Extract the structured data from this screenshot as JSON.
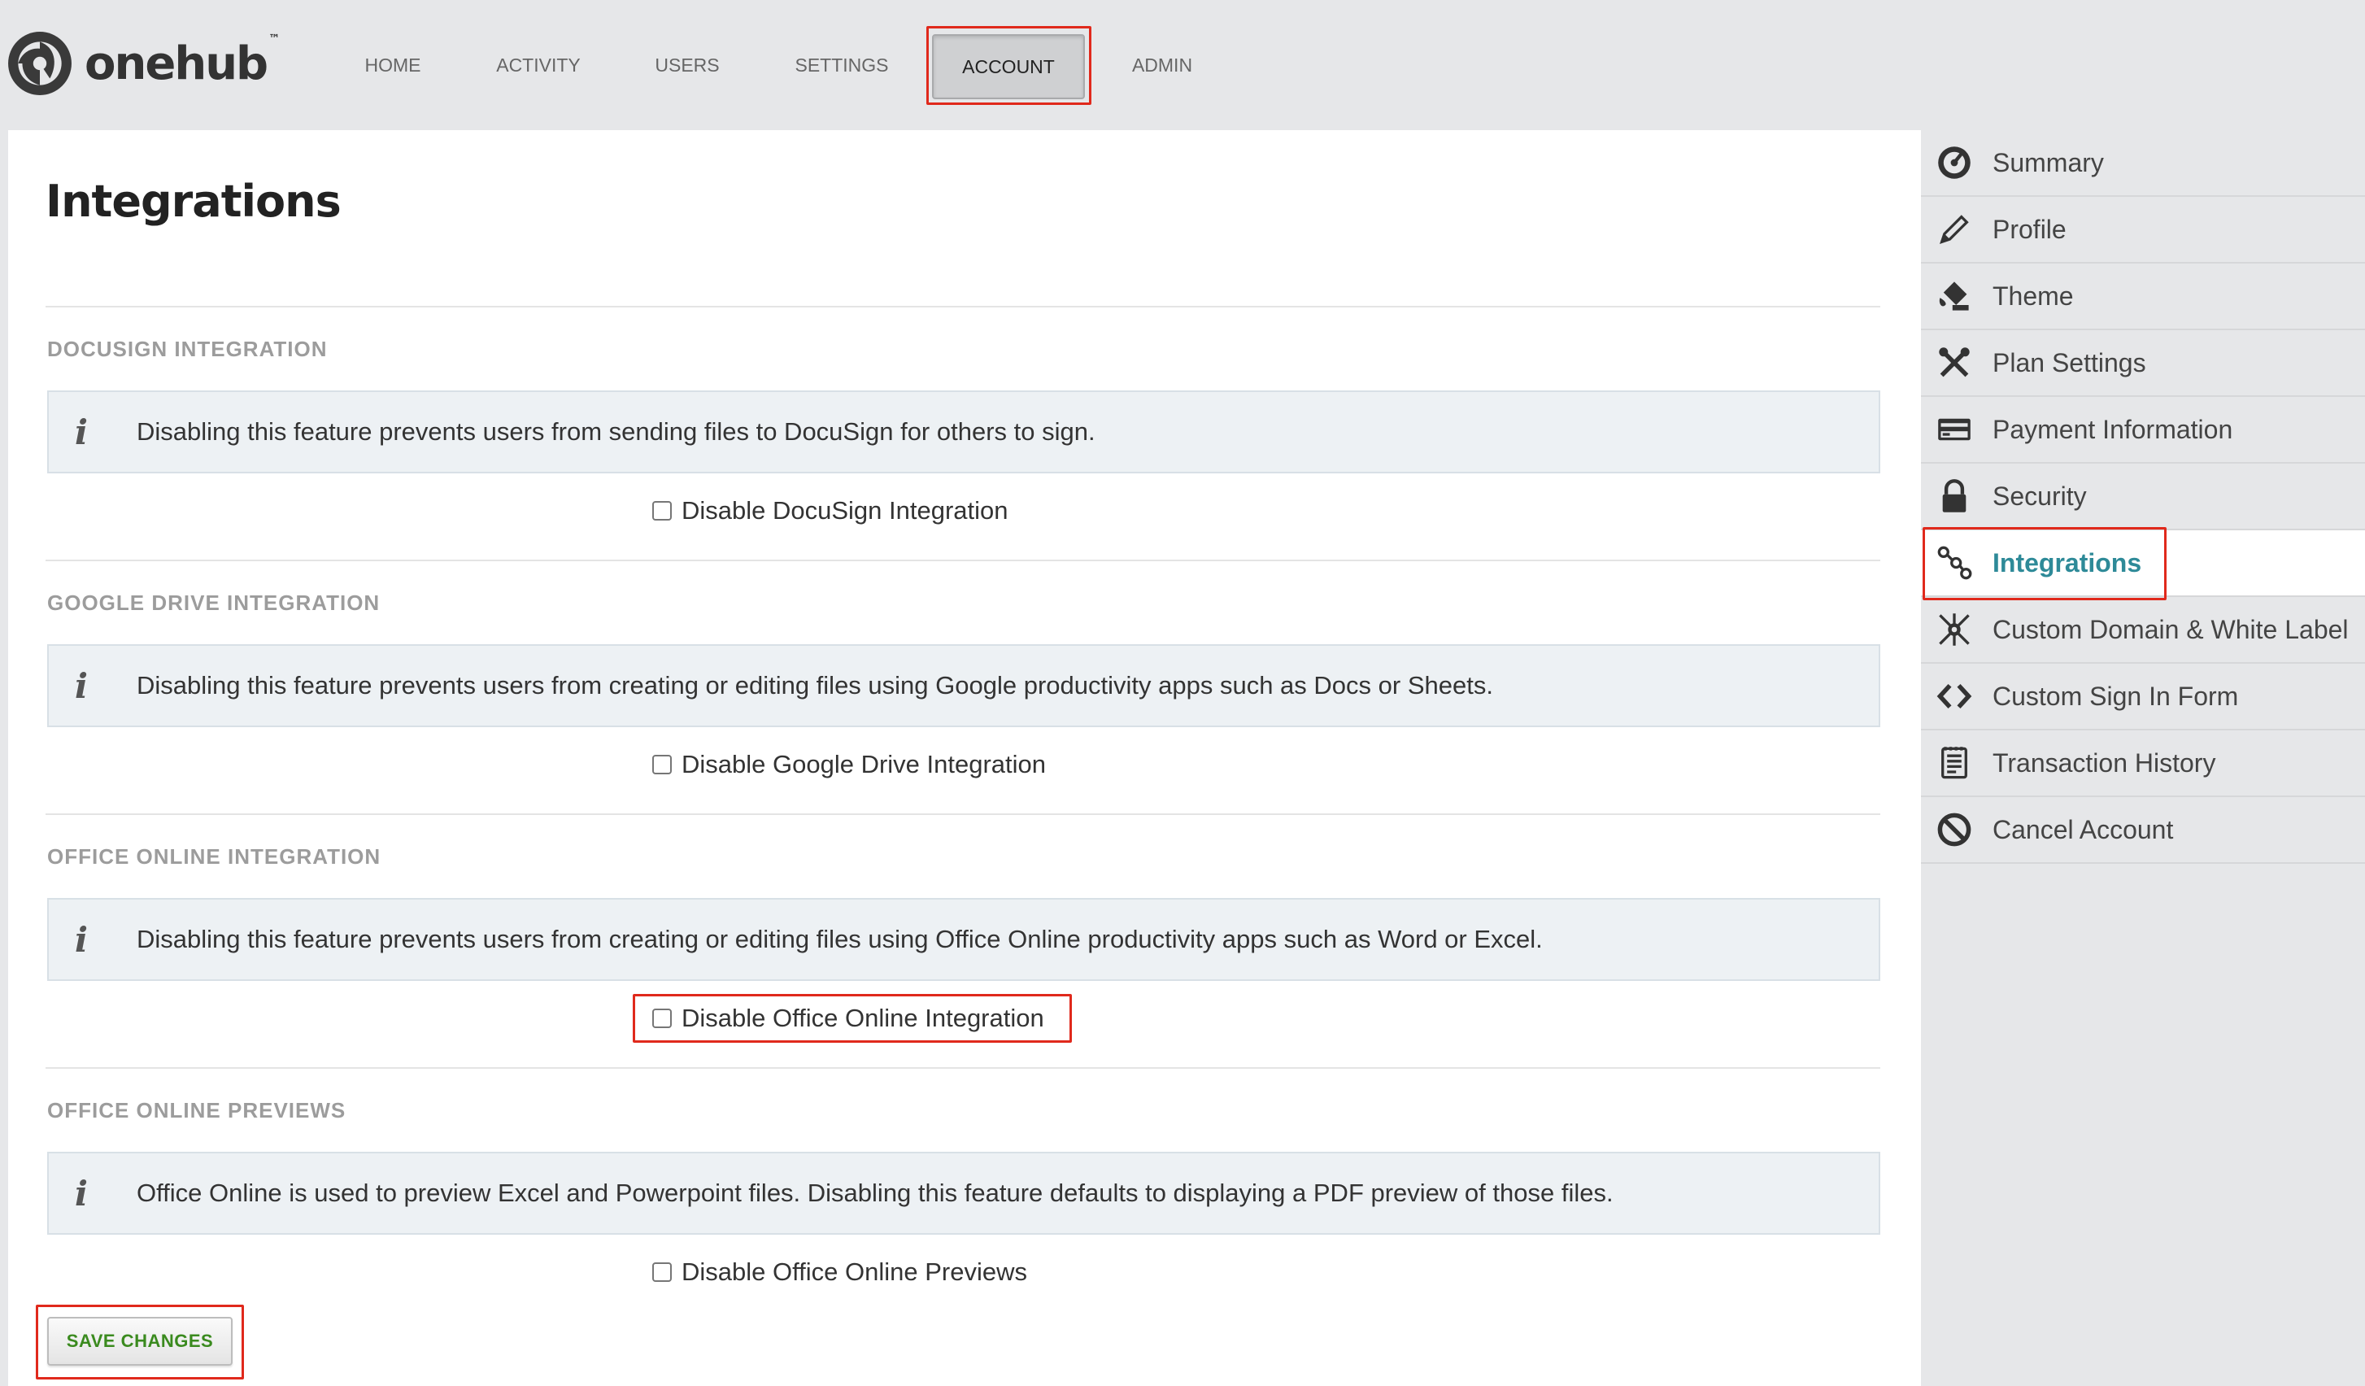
{
  "brand": {
    "name": "onehub",
    "tm": "™"
  },
  "nav": {
    "home": "HOME",
    "activity": "ACTIVITY",
    "users": "USERS",
    "settings": "SETTINGS",
    "account": "ACCOUNT",
    "admin": "ADMIN",
    "active": "ACCOUNT"
  },
  "page": {
    "title": "Integrations"
  },
  "sections": [
    {
      "title": "DOCUSIGN INTEGRATION",
      "info": "Disabling this feature prevents users from sending files to DocuSign for others to sign.",
      "checkbox_label": "Disable DocuSign Integration",
      "checked": false
    },
    {
      "title": "GOOGLE DRIVE INTEGRATION",
      "info": "Disabling this feature prevents users from creating or editing files using Google productivity apps such as Docs or Sheets.",
      "checkbox_label": "Disable Google Drive Integration",
      "checked": false
    },
    {
      "title": "OFFICE ONLINE INTEGRATION",
      "info": "Disabling this feature prevents users from creating or editing files using Office Online productivity apps such as Word or Excel.",
      "checkbox_label": "Disable Office Online Integration",
      "checked": false
    },
    {
      "title": "OFFICE ONLINE PREVIEWS",
      "info": "Office Online is used to preview Excel and Powerpoint files. Disabling this feature defaults to displaying a PDF preview of those files.",
      "checkbox_label": "Disable Office Online Previews",
      "checked": false
    }
  ],
  "info_icon": "i",
  "save_button": "SAVE CHANGES",
  "sidebar": {
    "active": "Integrations",
    "items": [
      {
        "label": "Summary",
        "icon": "gauge-icon"
      },
      {
        "label": "Profile",
        "icon": "pencil-icon"
      },
      {
        "label": "Theme",
        "icon": "paint-bucket-icon"
      },
      {
        "label": "Plan Settings",
        "icon": "tools-icon"
      },
      {
        "label": "Payment Information",
        "icon": "credit-card-icon"
      },
      {
        "label": "Security",
        "icon": "lock-icon"
      },
      {
        "label": "Integrations",
        "icon": "link-nodes-icon"
      },
      {
        "label": "Custom Domain & White Label",
        "icon": "satellite-icon"
      },
      {
        "label": "Custom Sign In Form",
        "icon": "code-brackets-icon"
      },
      {
        "label": "Transaction History",
        "icon": "receipt-icon"
      },
      {
        "label": "Cancel Account",
        "icon": "ban-icon"
      }
    ]
  },
  "colors": {
    "accent": "#2e8a98",
    "save_text": "#3a8a1e",
    "highlight_box": "#e0291c",
    "info_bg": "#edf1f4",
    "header_bg": "#e6e7e9"
  }
}
